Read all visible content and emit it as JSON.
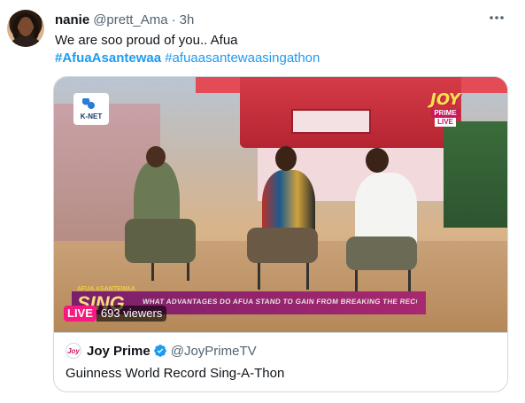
{
  "tweet": {
    "author_name": "nanie",
    "author_handle": "@prett_Ama",
    "separator": "·",
    "time": "3h",
    "more_icon": "more-horizontal-icon",
    "text": "We are soo proud of you.. Afua",
    "hashtags": [
      "#AfuaAsantewaa",
      "#afuaasantewaasingathon"
    ]
  },
  "media": {
    "live_label": "LIVE",
    "viewers": "693 viewers",
    "overlay_logo_left": "K-NET",
    "overlay_logo_right": [
      "JOY",
      "PRIME",
      "LIVE"
    ],
    "lower_third_small": "AFUA ASANTEWAA",
    "lower_third_big": "SING",
    "lower_third_text": "WHAT ADVANTAGES DO AFUA STAND TO GAIN FROM BREAKING THE RECORD?"
  },
  "card": {
    "source_name": "Joy Prime",
    "source_handle": "@JoyPrimeTV",
    "source_avatar_text": "Joy",
    "verified_icon": "verified-badge-icon",
    "title": "Guinness World Record Sing-A-Thon"
  },
  "colors": {
    "link": "#1d9bf0",
    "live_badge": "#f91880",
    "verified": "#1d9bf0",
    "text_secondary": "#536471"
  }
}
